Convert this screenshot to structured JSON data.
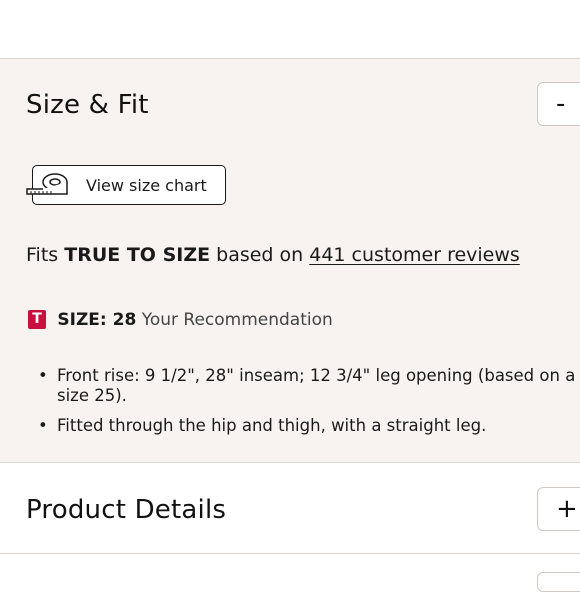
{
  "size_fit": {
    "title": "Size & Fit",
    "toggle_symbol": "-",
    "view_size_chart_label": "View size chart",
    "fit_prefix": "Fits",
    "fit_emphasis": "TRUE TO SIZE",
    "fit_middle": "based on",
    "reviews_link": "441 customer reviews",
    "recommendation": {
      "badge": "T",
      "size_label": "SIZE: 28",
      "text": "Your Recommendation"
    },
    "bullets": [
      "Front rise: 9 1/2\", 28\" inseam; 12 3/4\" leg opening (based on a size 25).",
      "Fitted through the hip and thigh, with a straight leg."
    ]
  },
  "product_details": {
    "title": "Product Details",
    "toggle_symbol": "+"
  },
  "colors": {
    "panel_bg": "#f8f3f1",
    "badge_red": "#c8103e",
    "divider": "#d9d4d0"
  }
}
